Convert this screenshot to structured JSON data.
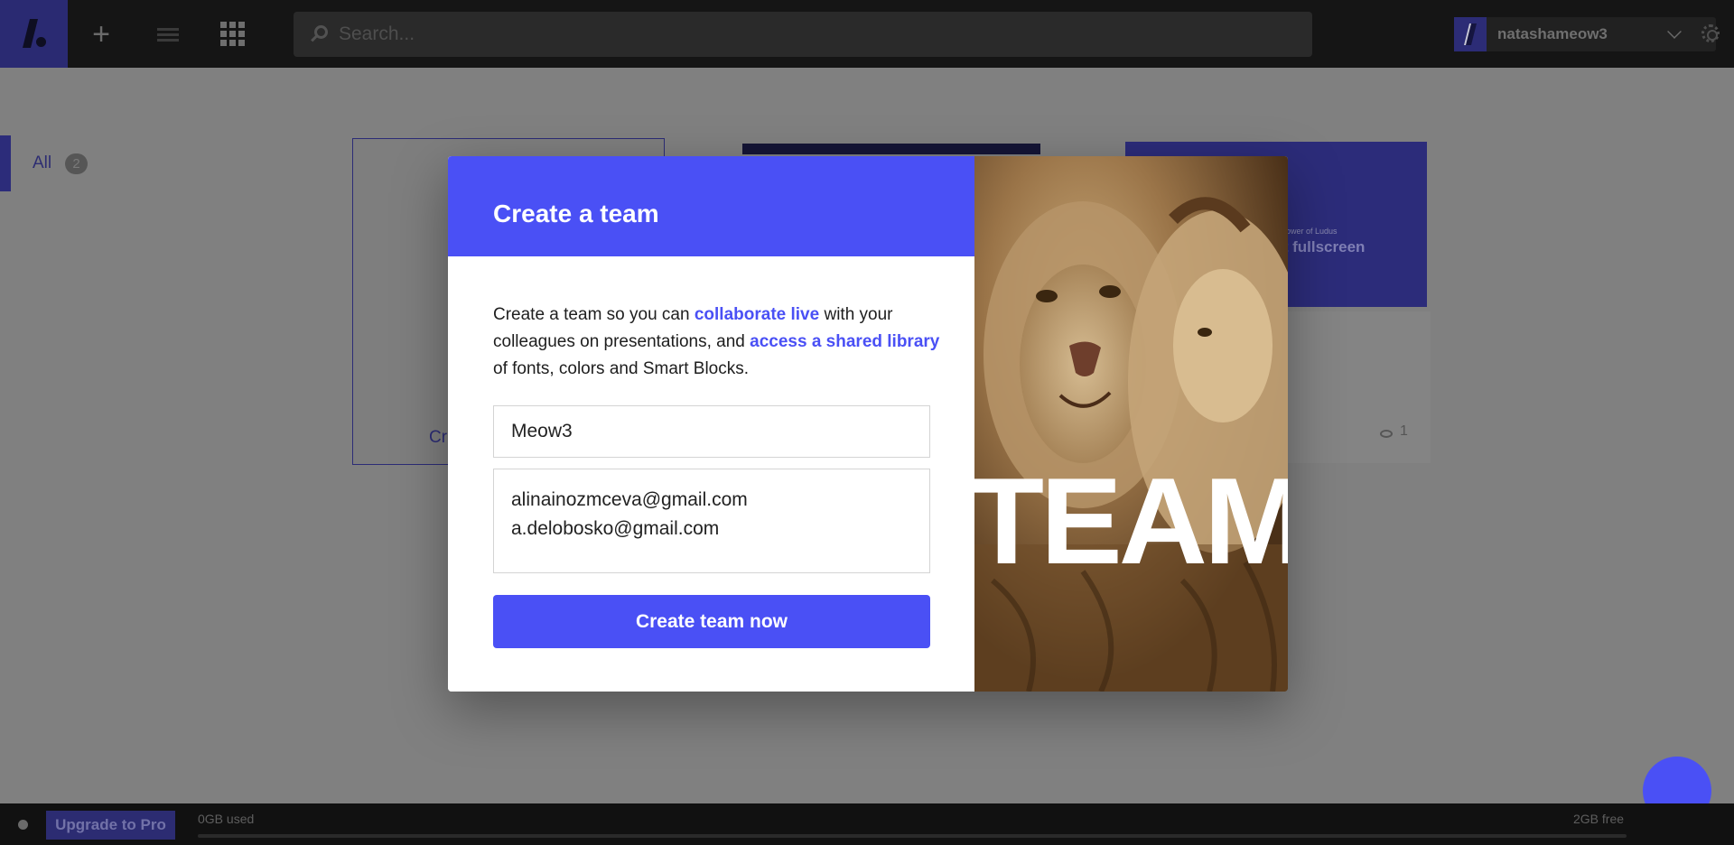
{
  "topbar": {
    "search_placeholder": "Search...",
    "username": "natashameow3"
  },
  "sidebar": {
    "all_label": "All",
    "all_count": "2"
  },
  "cards": {
    "create_text": "Cr",
    "thumb_small_text": "ower of Ludus",
    "thumb_big_text": "it fullscreen",
    "views": "1"
  },
  "modal": {
    "title": "Create a team",
    "desc_part1": "Create a team so you can ",
    "desc_hl1": "collaborate live",
    "desc_part2": " with your colleagues on presentations, and ",
    "desc_hl2": "access a shared library",
    "desc_part3": " of fonts, colors and Smart Blocks.",
    "team_name_value": "Meow3",
    "emails_value": "alinainozmceva@gmail.com\na.delobosko@gmail.com",
    "submit_label": "Create team now",
    "image_word": "TEAM"
  },
  "bottombar": {
    "upgrade_label": "Upgrade to Pro",
    "storage_used": "0GB used",
    "storage_free": "2GB free"
  },
  "colors": {
    "accent": "#4a50f5",
    "overlay": "#808080"
  },
  "icons": [
    "logo-icon",
    "plus-icon",
    "list-icon",
    "grid-icon",
    "search-icon",
    "chevron-down-icon",
    "gear-icon",
    "eye-icon"
  ]
}
